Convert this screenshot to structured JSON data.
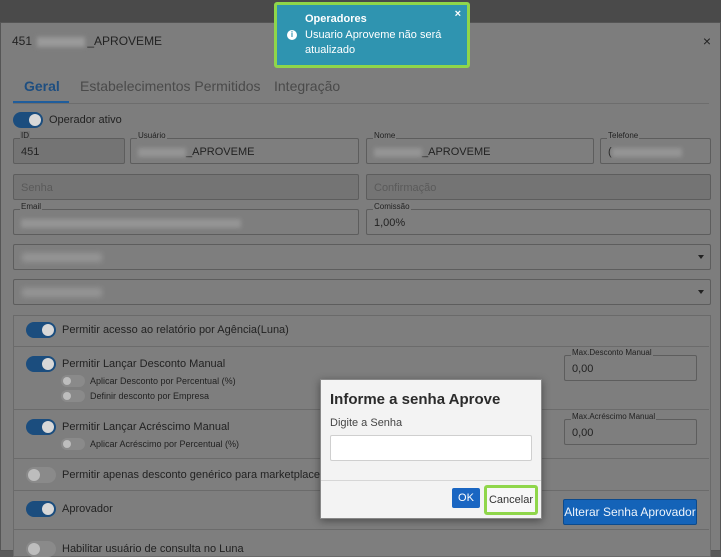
{
  "window": {
    "title_prefix": "451",
    "title_suffix": "_APROVEME",
    "close_glyph": "×"
  },
  "tabs": [
    {
      "label": "Geral"
    },
    {
      "label": "Estabelecimentos Permitidos"
    },
    {
      "label": "Integração"
    }
  ],
  "operador_ativo": {
    "label": "Operador ativo",
    "on": true
  },
  "fields": {
    "id": {
      "caption": "ID",
      "value": "451"
    },
    "usuario": {
      "caption": "Usuário",
      "value": "_APROVEME"
    },
    "nome": {
      "caption": "Nome",
      "value": "_APROVEME"
    },
    "telefone": {
      "caption": "Telefone",
      "value": "("
    },
    "senha": {
      "placeholder": "Senha"
    },
    "confirmacao": {
      "placeholder": "Confirmação"
    },
    "email": {
      "caption": "Email"
    },
    "comissao": {
      "caption": "Comissão",
      "value": "1,00%"
    }
  },
  "permissions": {
    "relatorio": {
      "label": "Permitir acesso ao relatório por Agência(Luna)",
      "on": true
    },
    "desconto": {
      "label": "Permitir Lançar Desconto Manual",
      "on": true
    },
    "desconto_percentual": {
      "label": "Aplicar Desconto por Percentual (%)",
      "on": false
    },
    "desconto_empresa": {
      "label": "Definir desconto por Empresa",
      "on": false
    },
    "max_desconto": {
      "caption": "Max.Desconto Manual",
      "value": "0,00"
    },
    "acrescimo": {
      "label": "Permitir Lançar Acréscimo Manual",
      "on": true
    },
    "acrescimo_percentual": {
      "label": "Aplicar Acréscimo por Percentual (%)",
      "on": false
    },
    "max_acrescimo": {
      "caption": "Max.Acréscimo Manual",
      "value": "0,00"
    },
    "marketplace": {
      "label": "Permitir apenas desconto genérico para marketplace",
      "on": false
    },
    "aprovador": {
      "label": "Aprovador",
      "on": true
    },
    "alterar_senha_label": "Alterar Senha Aprovador",
    "luna": {
      "label": "Habilitar usuário de consulta no Luna",
      "on": false
    }
  },
  "dialog": {
    "title": "Informe a senha Aprove",
    "subtitle": "Digite a Senha",
    "ok_label": "OK",
    "cancel_label": "Cancelar"
  },
  "toast": {
    "title": "Operadores",
    "message": "Usuario Aproveme não será atualizado",
    "close_glyph": "×",
    "icon": "info-icon"
  },
  "colors": {
    "primary_blue": "#1463b8",
    "toggle_on": "#1b4d7e",
    "toast_bg": "#2f94b0",
    "highlight_green": "#8fd64a"
  }
}
